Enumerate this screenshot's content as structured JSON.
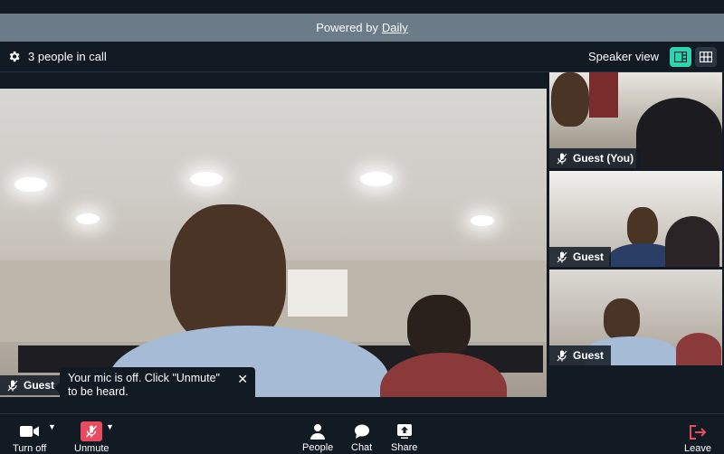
{
  "banner": {
    "prefix": "Powered by",
    "link": "Daily"
  },
  "header": {
    "settings_icon": "gear-icon",
    "participant_count": "3 people in call",
    "view_label": "Speaker view",
    "speaker_view_icon": "speaker-view-icon",
    "grid_view_icon": "grid-view-icon"
  },
  "main_video": {
    "name": "Guest",
    "icon": "mic-off-icon"
  },
  "tooltip": {
    "text": "Your mic is off. Click \"Unmute\" to be heard.",
    "close": "✕"
  },
  "tiles": [
    {
      "name": "Guest (You)",
      "icon": "mic-off-icon"
    },
    {
      "name": "Guest",
      "icon": "mic-off-icon"
    },
    {
      "name": "Guest",
      "icon": "mic-off-icon"
    }
  ],
  "toolbar": {
    "camera_label": "Turn off",
    "mute_label": "Unmute",
    "people_label": "People",
    "chat_label": "Chat",
    "share_label": "Share",
    "leave_label": "Leave",
    "leave_color": "#e84a5f",
    "accent_color": "#2bd5b0"
  }
}
